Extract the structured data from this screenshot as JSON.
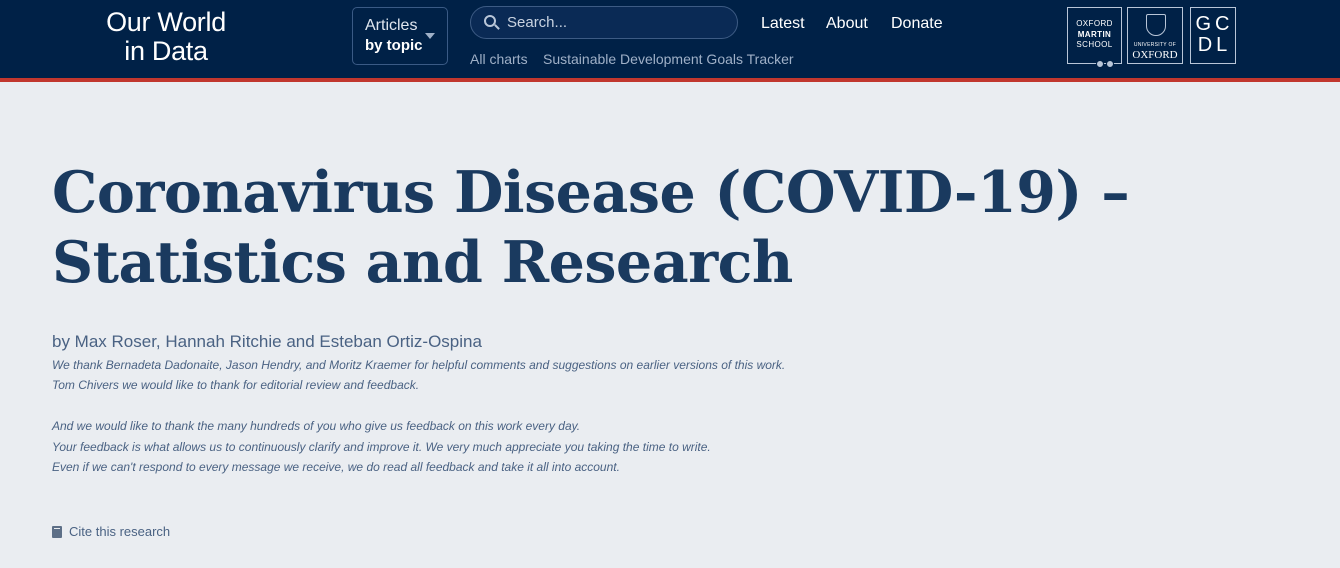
{
  "header": {
    "logo": {
      "line1": "Our World",
      "line2": "in Data"
    },
    "articles_button": {
      "line1": "Articles",
      "line2": "by topic"
    },
    "search": {
      "placeholder": "Search..."
    },
    "nav": [
      "Latest",
      "About",
      "Donate"
    ],
    "subnav": [
      "All charts",
      "Sustainable Development Goals Tracker"
    ],
    "partners": {
      "oxford_martin": [
        "OXFORD",
        "MARTIN",
        "SCHOOL"
      ],
      "university": {
        "small": "UNIVERSITY OF",
        "big": "OXFORD"
      },
      "gcdl": [
        "GC",
        "DL"
      ]
    }
  },
  "article": {
    "title": "Coronavirus Disease (COVID-19) – Statistics and Research",
    "byline": "by Max Roser, Hannah Ritchie and Esteban Ortiz-Ospina",
    "acknowledgements": [
      "We thank Bernadeta Dadonaite, Jason Hendry, and Moritz Kraemer for helpful comments and suggestions on earlier versions of this work.",
      "Tom Chivers we would like to thank for editorial review and feedback.",
      "And we would like to thank the many hundreds of you who give us feedback on this work every day.",
      "Your feedback is what allows us to continuously clarify and improve it. We very much appreciate you taking the time to write.",
      "Even if we can't respond to every message we receive, we do read all feedback and take it all into account."
    ],
    "cite_label": "Cite this research"
  },
  "colors": {
    "header_bg": "#002147",
    "accent": "#c1372e",
    "page_bg": "#eaedf1",
    "title": "#1a3a5f"
  },
  "icons": {
    "search": "search-icon",
    "caret": "chevron-down-icon",
    "cite": "book-icon"
  }
}
